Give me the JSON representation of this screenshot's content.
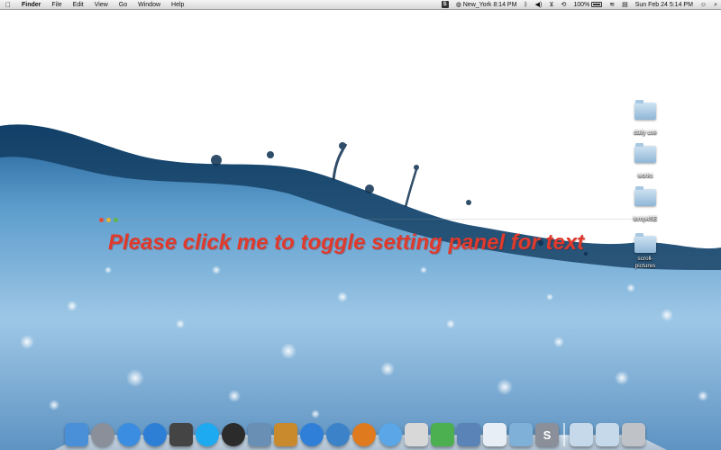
{
  "menubar": {
    "apple": "",
    "app_name": "Finder",
    "items": [
      "File",
      "Edit",
      "View",
      "Go",
      "Window",
      "Help"
    ],
    "clock_city": "New_York 8:14 PM",
    "battery": "100%",
    "date_time": "Sun Feb 24  5:14 PM",
    "s_badge": "S"
  },
  "desktop": {
    "folders": [
      {
        "label": "daily use"
      },
      {
        "label": "works"
      },
      {
        "label": "temp4SE"
      },
      {
        "label": "scroll-pictures"
      }
    ]
  },
  "widget": {
    "toggle_text": "Please click me to toggle setting panel for text"
  },
  "dock": {
    "apps": [
      {
        "icon": "finder-icon",
        "color": "#4a90d9"
      },
      {
        "icon": "launchpad-icon",
        "color": "#8a8f99"
      },
      {
        "icon": "itunes-icon",
        "color": "#3a8de0"
      },
      {
        "icon": "app-store-icon",
        "color": "#2d7fd6"
      },
      {
        "icon": "photo-booth-icon",
        "color": "#444444"
      },
      {
        "icon": "skype-icon",
        "color": "#1eaaf0"
      },
      {
        "icon": "dashboard-icon",
        "color": "#2b2b2b"
      },
      {
        "icon": "preview-icon",
        "color": "#6a8fb5"
      },
      {
        "icon": "pencil-app-icon",
        "color": "#c98a2e"
      },
      {
        "icon": "chrome-icon",
        "color": "#2f7fd8"
      },
      {
        "icon": "safari-icon",
        "color": "#3b82c9"
      },
      {
        "icon": "firefox-icon",
        "color": "#e07a1f"
      },
      {
        "icon": "messages-icon",
        "color": "#5aa6e6"
      },
      {
        "icon": "notes-icon",
        "color": "#d8d8d8"
      },
      {
        "icon": "mindmap-icon",
        "color": "#4caf50"
      },
      {
        "icon": "xcode-icon",
        "color": "#5a84b8"
      },
      {
        "icon": "textedit-icon",
        "color": "#e8eef5"
      },
      {
        "icon": "mail-icon",
        "color": "#7fb0d8"
      },
      {
        "icon": "s-app-icon",
        "color": "#8a8f99"
      }
    ],
    "stacks": [
      {
        "icon": "documents-stack-icon",
        "color": "#c6d9ea"
      },
      {
        "icon": "downloads-stack-icon",
        "color": "#c6d9ea"
      },
      {
        "icon": "trash-icon",
        "color": "#bfc3c8"
      }
    ],
    "s_label": "S"
  }
}
